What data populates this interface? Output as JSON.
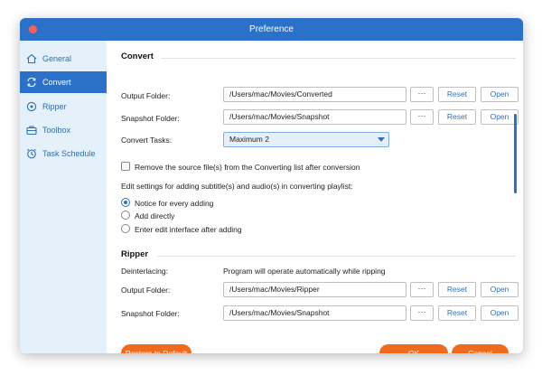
{
  "window": {
    "title": "Preference"
  },
  "sidebar": {
    "items": [
      {
        "label": "General",
        "icon": "home-icon"
      },
      {
        "label": "Convert",
        "icon": "refresh-icon"
      },
      {
        "label": "Ripper",
        "icon": "disc-icon"
      },
      {
        "label": "Toolbox",
        "icon": "toolbox-icon"
      },
      {
        "label": "Task Schedule",
        "icon": "clock-icon"
      }
    ],
    "active": "Convert"
  },
  "convert": {
    "title": "Convert",
    "output_label": "Output Folder:",
    "output_value": "/Users/mac/Movies/Converted",
    "snapshot_label": "Snapshot Folder:",
    "snapshot_value": "/Users/mac/Movies/Snapshot",
    "tasks_label": "Convert Tasks:",
    "tasks_value": "Maximum 2",
    "remove_checkbox_label": "Remove the source file(s) from the Converting list after conversion",
    "remove_checked": false,
    "edit_settings_text": "Edit settings for adding subtitle(s) and audio(s) in converting playlist:",
    "radio_options": [
      "Notice for every adding",
      "Add directly",
      "Enter edit interface after adding"
    ],
    "radio_selected": "Notice for every adding"
  },
  "ripper": {
    "title": "Ripper",
    "deinterlacing_label": "Deinterlacing:",
    "deinterlacing_text": "Program will operate automatically while ripping",
    "output_label": "Output Folder:",
    "output_value": "/Users/mac/Movies/Ripper",
    "snapshot_label": "Snapshot Folder:",
    "snapshot_value": "/Users/mac/Movies/Snapshot"
  },
  "buttons": {
    "dots": "···",
    "reset": "Reset",
    "open": "Open",
    "restore": "Restore to Default",
    "ok": "OK",
    "cancel": "Cancel"
  },
  "colors": {
    "accent": "#2b71c9",
    "orange": "#f06a1e",
    "sidebar_bg": "#e4f0fa"
  }
}
